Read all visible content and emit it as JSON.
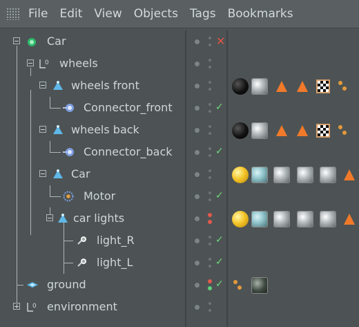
{
  "menu": {
    "items": [
      "File",
      "Edit",
      "View",
      "Objects",
      "Tags",
      "Bookmarks"
    ]
  },
  "tree": {
    "rows": [
      {
        "label": "Car",
        "icon": "null-object-icon"
      },
      {
        "label": "wheels",
        "icon": "null-zero-icon"
      },
      {
        "label": "wheels front",
        "icon": "symmetry-object-icon"
      },
      {
        "label": "Connector_front",
        "icon": "connector-icon"
      },
      {
        "label": "wheels back",
        "icon": "symmetry-object-icon"
      },
      {
        "label": "Connector_back",
        "icon": "connector-icon"
      },
      {
        "label": "Car",
        "icon": "symmetry-object-icon"
      },
      {
        "label": "Motor",
        "icon": "motor-icon"
      },
      {
        "label": "car lights",
        "icon": "symmetry-object-icon"
      },
      {
        "label": "light_R",
        "icon": "light-icon"
      },
      {
        "label": "light_L",
        "icon": "light-icon"
      },
      {
        "label": "ground",
        "icon": "plane-icon"
      },
      {
        "label": "environment",
        "icon": "null-zero-icon"
      }
    ]
  },
  "colors": {
    "background": "#4d5354",
    "menubar": "#5a6061",
    "text": "#cfd6d7",
    "enabled_check": "#6ed97a",
    "disabled_x": "#e05545",
    "uvw_tag": "#f07a2a"
  }
}
